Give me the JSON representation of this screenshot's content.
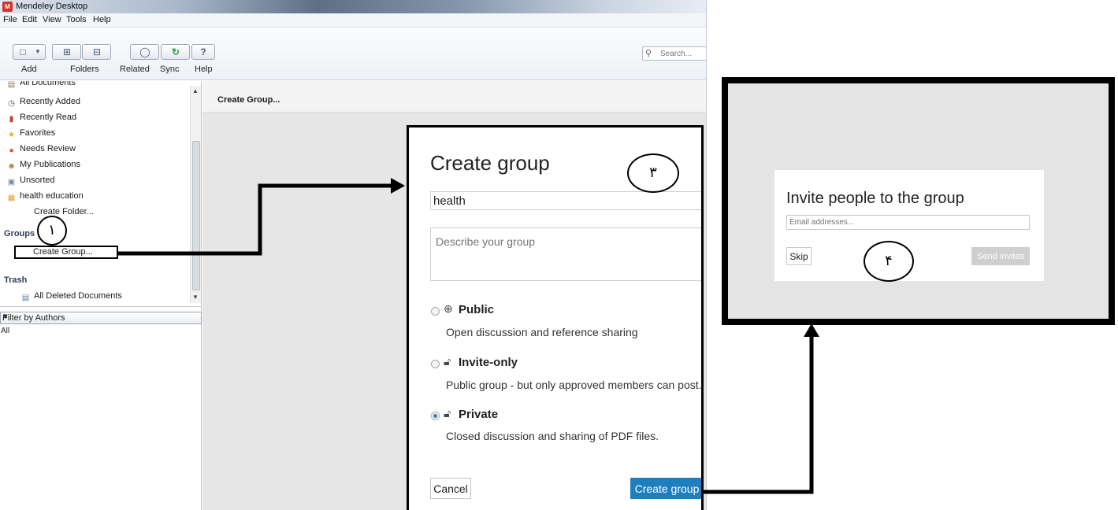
{
  "window": {
    "title": "Mendeley Desktop",
    "logo_text": "M"
  },
  "menu": [
    "File",
    "Edit",
    "View",
    "Tools",
    "Help"
  ],
  "toolbar": {
    "labels": {
      "add": "Add",
      "folders": "Folders",
      "related": "Related",
      "sync": "Sync",
      "help": "Help"
    },
    "icons": {
      "add": "add-document-icon",
      "add_dropdown": "dropdown-arrow-icon",
      "folder_add": "add-folder-icon",
      "folder_remove": "remove-folder-icon",
      "related": "related-icon",
      "sync": "sync-icon",
      "help": "help-icon"
    },
    "search_placeholder": "Search..."
  },
  "sidebar": {
    "library_items": [
      {
        "label": "All Documents",
        "icon": "documents-icon"
      },
      {
        "label": "Recently Added",
        "icon": "clock-icon"
      },
      {
        "label": "Recently Read",
        "icon": "book-icon"
      },
      {
        "label": "Favorites",
        "icon": "star-icon"
      },
      {
        "label": "Needs Review",
        "icon": "review-icon"
      },
      {
        "label": "My Publications",
        "icon": "person-icon"
      },
      {
        "label": "Unsorted",
        "icon": "unsorted-icon"
      },
      {
        "label": "health education",
        "icon": "folder-icon"
      },
      {
        "label": "Create Folder...",
        "icon": ""
      }
    ],
    "groups_heading": "Groups",
    "create_group": "Create Group...",
    "trash_heading": "Trash",
    "trash_item": "All Deleted Documents",
    "filter_label": "Filter by Authors",
    "filter_all": "All"
  },
  "content": {
    "header": "Create Group..."
  },
  "create_dialog": {
    "title": "Create group",
    "name_value": "health",
    "description_placeholder": "Describe your group",
    "options": [
      {
        "title": "Public",
        "description": "Open discussion and reference sharing",
        "icon": "globe-icon",
        "selected": false
      },
      {
        "title": "Invite-only",
        "description": "Public group - but only approved members can post.",
        "icon": "lock-icon",
        "selected": false
      },
      {
        "title": "Private",
        "description": "Closed discussion and sharing of PDF files.",
        "icon": "lock-icon",
        "selected": true
      }
    ],
    "cancel_label": "Cancel",
    "submit_label": "Create group",
    "accent_color": "#1e7fbe"
  },
  "invite_dialog": {
    "title": "Invite people to the group",
    "email_placeholder": "Email addresses...",
    "skip_label": "Skip",
    "send_label": "Send invites"
  },
  "annotations": {
    "step1": "١",
    "step3": "٣",
    "step4": "۴"
  }
}
